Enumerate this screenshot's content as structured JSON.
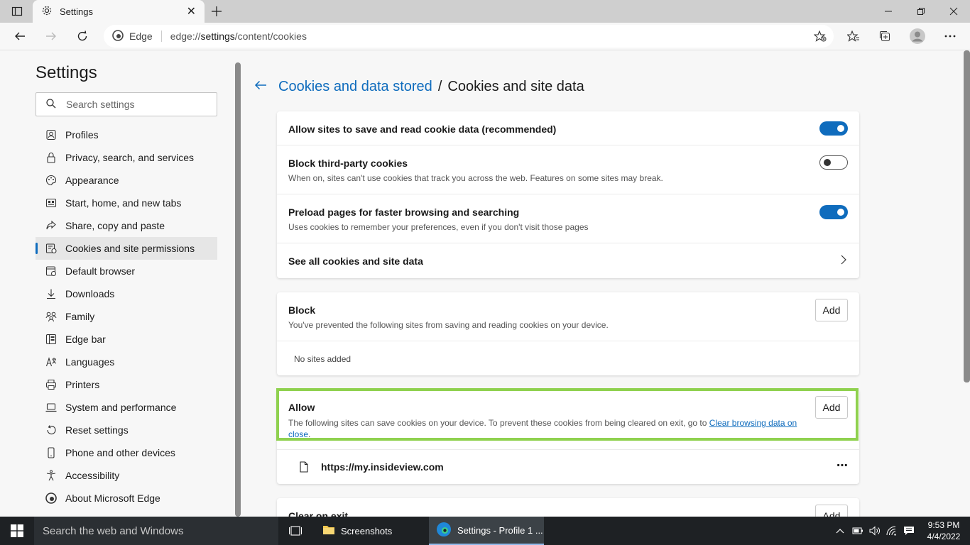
{
  "browser": {
    "tab_title": "Settings",
    "omnibox_label": "Edge",
    "url_prefix": "edge://",
    "url_host": "settings",
    "url_path": "/content/cookies"
  },
  "sidebar": {
    "title": "Settings",
    "search_placeholder": "Search settings",
    "items": [
      {
        "label": "Profiles",
        "icon": "profile-icon"
      },
      {
        "label": "Privacy, search, and services",
        "icon": "lock-icon"
      },
      {
        "label": "Appearance",
        "icon": "palette-icon"
      },
      {
        "label": "Start, home, and new tabs",
        "icon": "start-icon"
      },
      {
        "label": "Share, copy and paste",
        "icon": "share-icon"
      },
      {
        "label": "Cookies and site permissions",
        "icon": "cookies-icon",
        "active": true
      },
      {
        "label": "Default browser",
        "icon": "browser-icon"
      },
      {
        "label": "Downloads",
        "icon": "download-icon"
      },
      {
        "label": "Family",
        "icon": "family-icon"
      },
      {
        "label": "Edge bar",
        "icon": "edgebar-icon"
      },
      {
        "label": "Languages",
        "icon": "language-icon"
      },
      {
        "label": "Printers",
        "icon": "printer-icon"
      },
      {
        "label": "System and performance",
        "icon": "laptop-icon"
      },
      {
        "label": "Reset settings",
        "icon": "reset-icon"
      },
      {
        "label": "Phone and other devices",
        "icon": "phone-icon"
      },
      {
        "label": "Accessibility",
        "icon": "accessibility-icon"
      },
      {
        "label": "About Microsoft Edge",
        "icon": "edge-logo-icon"
      }
    ]
  },
  "main": {
    "breadcrumb_parent": "Cookies and data stored",
    "breadcrumb_separator": "/",
    "breadcrumb_current": "Cookies and site data",
    "settings": {
      "allow_cookies": {
        "title": "Allow sites to save and read cookie data (recommended)",
        "enabled": true
      },
      "block_third_party": {
        "title": "Block third-party cookies",
        "desc": "When on, sites can't use cookies that track you across the web. Features on some sites may break.",
        "enabled": false
      },
      "preload": {
        "title": "Preload pages for faster browsing and searching",
        "desc": "Uses cookies to remember your preferences, even if you don't visit those pages",
        "enabled": true
      },
      "see_all": {
        "title": "See all cookies and site data"
      }
    },
    "block": {
      "title": "Block",
      "desc": "You've prevented the following sites from saving and reading cookies on your device.",
      "add_label": "Add",
      "empty_text": "No sites added"
    },
    "allow": {
      "title": "Allow",
      "desc": "The following sites can save cookies on your device. To prevent these cookies from being cleared on exit, go to",
      "link_text": "Clear browsing data on close",
      "period": ".",
      "add_label": "Add",
      "sites": [
        "https://my.insideview.com"
      ],
      "more_label": "⋯"
    },
    "clear_on_exit": {
      "title": "Clear on exit",
      "add_label": "Add"
    }
  },
  "taskbar": {
    "search_placeholder": "Search the web and Windows",
    "apps": [
      {
        "label": "Screenshots"
      },
      {
        "label": "Settings - Profile 1 ..."
      }
    ],
    "time": "9:53 PM",
    "date": "4/4/2022"
  },
  "colors": {
    "accent": "#0f6cbd",
    "highlight": "#8fd14f"
  }
}
